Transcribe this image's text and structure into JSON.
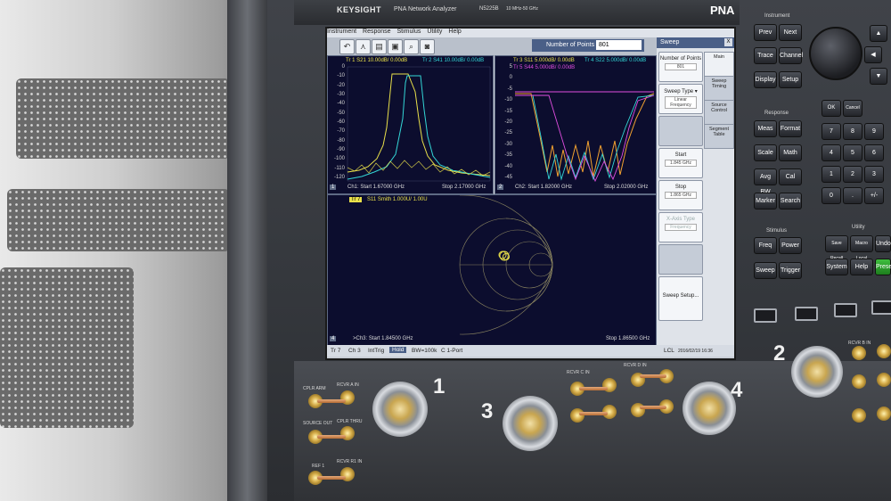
{
  "instrument": {
    "brand": "KEYSIGHT",
    "model_title": "PNA Network Analyzer",
    "model_number": "N5225B",
    "freq_range": "10 MHz-50 GHz",
    "badge": "PNA"
  },
  "menubar": [
    "Instrument",
    "Response",
    "Stimulus",
    "Utility",
    "Help"
  ],
  "toolbar": {
    "number_of_points_label": "Number of Points",
    "number_of_points_value": "801"
  },
  "window1": {
    "header_line1a": "Tr 1  S21 10.00dB/ 0.00dB",
    "header_line1b": "Tr 2  S41 10.00dB/ 0.00dB",
    "yticks": [
      "0",
      "-10",
      "-20",
      "-30",
      "-40",
      "-50",
      "-60",
      "-70",
      "-80",
      "-90",
      "-100",
      "-110",
      "-120"
    ],
    "num": "1",
    "footer_start": "Ch1: Start  1.67000 GHz",
    "footer_stop": "Stop  2.17000 GHz"
  },
  "window2": {
    "header_line1a": "Tr 3  S11 5.000dB/ 0.00dB",
    "header_line1b": "Tr 4  S22 5.000dB/ 0.00dB",
    "header_line2": "Tr 5  S44 5.000dB/ 0.00dB",
    "yticks": [
      "5",
      "0",
      "-5",
      "-10",
      "-15",
      "-20",
      "-25",
      "-30",
      "-35",
      "-40",
      "-45"
    ],
    "num": "2",
    "footer_start": "Ch2: Start  1.82000 GHz",
    "footer_stop": "Stop  2.02000 GHz"
  },
  "window3": {
    "trace_tag": "Tr 7",
    "header": "S11 Smith 1.000U/  1.00U",
    "num": "4",
    "footer_start": ">Ch3: Start  1.84500 GHz",
    "footer_stop": "Stop  1.86500 GHz"
  },
  "sidepanel": {
    "title": "Sweep",
    "close": "X",
    "buttons": [
      {
        "label": "Number of Points",
        "value": "801"
      },
      {
        "label": "Sweep Type ▾",
        "value": "Linear Frequency"
      },
      {
        "label": "Start",
        "value": "1.845 GHz"
      },
      {
        "label": "Stop",
        "value": "1.865 GHz"
      },
      {
        "label": "X-Axis Type",
        "value": "Frequency"
      },
      {
        "label": "Sweep Setup..."
      }
    ],
    "tabs": [
      "Main",
      "Sweep Timing",
      "Source Control",
      "Segment Table"
    ]
  },
  "statusbar": {
    "items": [
      "Tr 7",
      "Ch 3",
      "IntTrig",
      "Hold",
      "BW=100k",
      "C  1-Port"
    ],
    "lcl": "LCL",
    "datetime": "2016/02/19 16:36"
  },
  "frontpanel": {
    "instrument_section": "Instrument",
    "instrument_keys": [
      "Prev",
      "Next",
      "Trace",
      "Channel",
      "Display",
      "Setup"
    ],
    "response_section": "Response",
    "response_keys": [
      "Meas",
      "Format",
      "Scale",
      "Math",
      "Avg BW",
      "Cal",
      "Marker",
      "Search"
    ],
    "stimulus_section": "Stimulus",
    "stimulus_keys": [
      "Freq",
      "Power",
      "Sweep",
      "Trigger"
    ],
    "utility_section": "Utility",
    "utility_keys": [
      "Save Recall",
      "Macro Local",
      "Undo",
      "System",
      "Help",
      "Preset"
    ],
    "entry_keys": [
      "OK",
      "Cancel",
      "7",
      "8",
      "9",
      "4",
      "5",
      "6",
      "1",
      "2",
      "3",
      "0",
      ".",
      "+/-"
    ]
  },
  "ports": {
    "port1": "1",
    "port2": "2",
    "port3": "3",
    "port4": "4",
    "labels": [
      "CPLR ARM",
      "RCVR A IN",
      "SOURCE OUT",
      "CPLR THRU",
      "RCVR R1 IN",
      "REF 1",
      "RCVR C IN",
      "RCVR D IN",
      "RCVR B IN"
    ]
  },
  "colors": {
    "trace_yellow": "#e9e04a",
    "trace_cyan": "#33d6d6",
    "trace_magenta": "#e04ee0",
    "trace_orange": "#f0a030",
    "plot_bg": "#0c0d2e",
    "header_blue": "#4a5f87",
    "preset_green": "#2fa02f"
  }
}
